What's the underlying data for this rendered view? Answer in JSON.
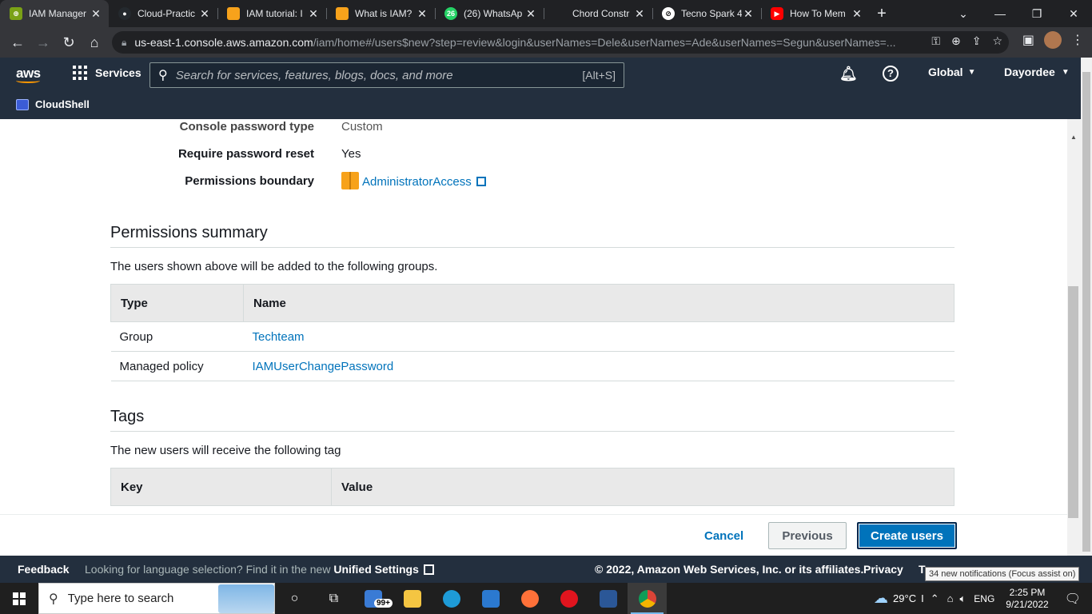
{
  "browser": {
    "tabs": [
      {
        "title": "IAM Manager",
        "icon": "aws-iam-icon",
        "color": "#7aa116",
        "active": true
      },
      {
        "title": "Cloud-Practic",
        "icon": "github-icon",
        "color": "#24292e",
        "active": false
      },
      {
        "title": "IAM tutorial: I",
        "icon": "aws-box-icon",
        "color": "#f7a21b",
        "active": false
      },
      {
        "title": "What is IAM?",
        "icon": "aws-box-icon",
        "color": "#f7a21b",
        "active": false
      },
      {
        "title": "(26) WhatsAp",
        "icon": "whatsapp-icon",
        "color": "#25d366",
        "active": false
      },
      {
        "title": "Chord Constr",
        "icon": "blank-icon",
        "color": "#202124",
        "active": false
      },
      {
        "title": "Tecno Spark 4",
        "icon": "tecno-icon",
        "color": "#ffffff",
        "active": false
      },
      {
        "title": "How To Mem",
        "icon": "youtube-icon",
        "color": "#ff0000",
        "active": false
      }
    ],
    "url_host": "us-east-1.console.aws.amazon.com",
    "url_path": "/iam/home#/users$new?step=review&login&userNames=Dele&userNames=Ade&userNames=Segun&userNames=..."
  },
  "aws_nav": {
    "logo": "aws",
    "services_label": "Services",
    "search_placeholder": "Search for services, features, blogs, docs, and more",
    "search_shortcut": "[Alt+S]",
    "region": "Global",
    "account": "Dayordee",
    "cloudshell": "CloudShell"
  },
  "details": {
    "partial_label": "Console password type",
    "partial_value": "Custom",
    "reset_label": "Require password reset",
    "reset_value": "Yes",
    "boundary_label": "Permissions boundary",
    "boundary_value": "AdministratorAccess"
  },
  "permissions_summary": {
    "title": "Permissions summary",
    "description": "The users shown above will be added to the following groups.",
    "columns": [
      "Type",
      "Name"
    ],
    "rows": [
      {
        "type": "Group",
        "name": "Techteam"
      },
      {
        "type": "Managed policy",
        "name": "IAMUserChangePassword"
      }
    ]
  },
  "tags": {
    "title": "Tags",
    "description": "The new users will receive the following tag",
    "columns": [
      "Key",
      "Value"
    ]
  },
  "actions": {
    "cancel": "Cancel",
    "previous": "Previous",
    "create": "Create users"
  },
  "footer": {
    "feedback": "Feedback",
    "language_text": "Looking for language selection? Find it in the new",
    "unified_settings": "Unified Settings",
    "copyright": "© 2022, Amazon Web Services, Inc. or its affiliates.",
    "privacy": "Privacy",
    "terms": "T",
    "notification_tooltip": "34 new notifications (Focus assist on)"
  },
  "taskbar": {
    "search_placeholder": "Type here to search",
    "mail_badge": "99+",
    "weather": "29°C",
    "language": "ENG",
    "time": "2:25 PM",
    "date": "9/21/2022"
  },
  "colors": {
    "aws_nav": "#232f3e",
    "link": "#0073bb",
    "primary_button": "#0073bb"
  }
}
